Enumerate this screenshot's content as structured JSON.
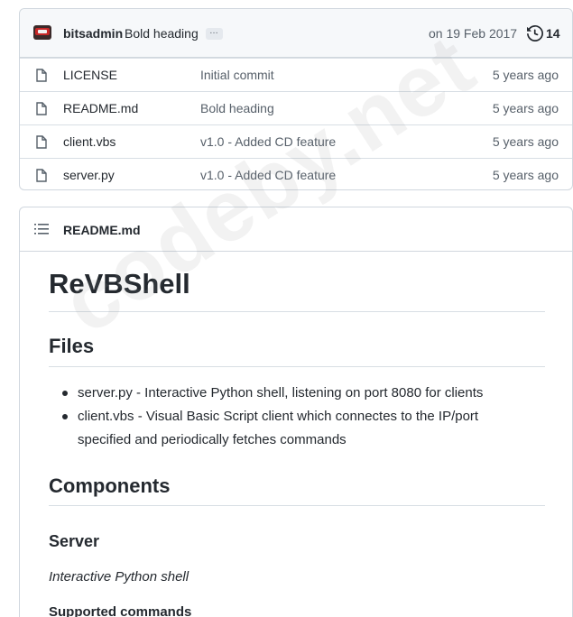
{
  "commit": {
    "author": "bitsadmin",
    "message": "Bold heading",
    "ellipsis": "…",
    "date": "on 19 Feb 2017",
    "count": "14"
  },
  "files": [
    {
      "name": "LICENSE",
      "commit": "Initial commit",
      "age": "5 years ago"
    },
    {
      "name": "README.md",
      "commit": "Bold heading",
      "age": "5 years ago"
    },
    {
      "name": "client.vbs",
      "commit": "v1.0 - Added CD feature",
      "age": "5 years ago"
    },
    {
      "name": "server.py",
      "commit": "v1.0 - Added CD feature",
      "age": "5 years ago"
    }
  ],
  "readme": {
    "filename": "README.md",
    "title": "ReVBShell",
    "files_heading": "Files",
    "items": [
      "server.py - Interactive Python shell, listening on port 8080 for clients",
      "client.vbs - Visual Basic Script client which connectes to the IP/port specified and periodically fetches commands"
    ],
    "components_heading": "Components",
    "server_heading": "Server",
    "server_desc": "Interactive Python shell",
    "supported_heading": "Supported commands"
  },
  "watermark": "codeby.net",
  "icons": {
    "avatar": "user-avatar",
    "history": "history-clock-icon",
    "file": "file-icon",
    "toc": "list-icon"
  }
}
